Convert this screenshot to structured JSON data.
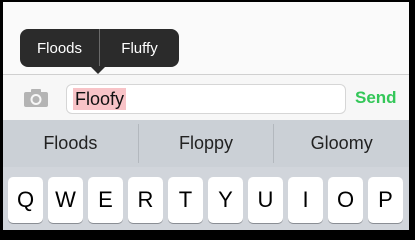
{
  "autocorrect": {
    "options": [
      "Floods",
      "Fluffy"
    ]
  },
  "input": {
    "value": "Floofy",
    "send_label": "Send",
    "camera_icon": "camera-icon"
  },
  "predictions": [
    "Floods",
    "Floppy",
    "Gloomy"
  ],
  "keyboard": {
    "row1": [
      "Q",
      "W",
      "E",
      "R",
      "T",
      "Y",
      "U",
      "I",
      "O",
      "P"
    ]
  },
  "colors": {
    "send": "#34c759",
    "misspelled_highlight": "#f8c3c7",
    "bubble": "#2b2b2b"
  }
}
